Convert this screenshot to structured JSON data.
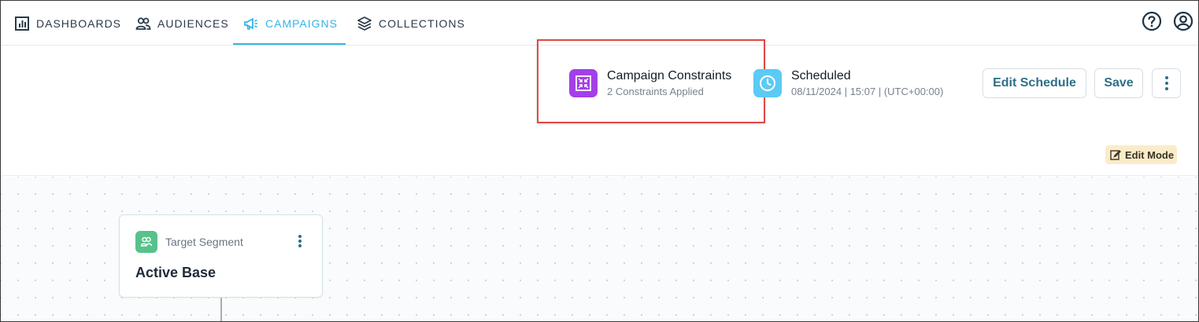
{
  "nav": {
    "items": [
      {
        "label": "DASHBOARDS",
        "icon": "dashboard-chart-icon"
      },
      {
        "label": "AUDIENCES",
        "icon": "users-icon"
      },
      {
        "label": "CAMPAIGNS",
        "icon": "megaphone-icon",
        "active": true
      },
      {
        "label": "COLLECTIONS",
        "icon": "layers-icon"
      }
    ],
    "help_icon": "help-circle-icon",
    "account_icon": "user-circle-icon",
    "active_color": "#35b4e4"
  },
  "header": {
    "constraints": {
      "title": "Campaign Constraints",
      "subtitle": "2 Constraints Applied",
      "icon": "constraints-icon",
      "color": "#a33fe9"
    },
    "schedule": {
      "title": "Scheduled",
      "subtitle": "08/11/2024 | 15:07 | (UTC+00:00)",
      "icon": "clock-icon",
      "color": "#5ccaf5"
    },
    "buttons": {
      "edit_schedule": "Edit Schedule",
      "save": "Save",
      "more_icon": "more-vertical-icon"
    },
    "edit_mode_label": "Edit Mode",
    "highlight_color": "#e04848"
  },
  "canvas": {
    "node": {
      "type_label": "Target Segment",
      "title": "Active Base",
      "icon": "segment-users-icon",
      "color": "#58c28b"
    }
  }
}
